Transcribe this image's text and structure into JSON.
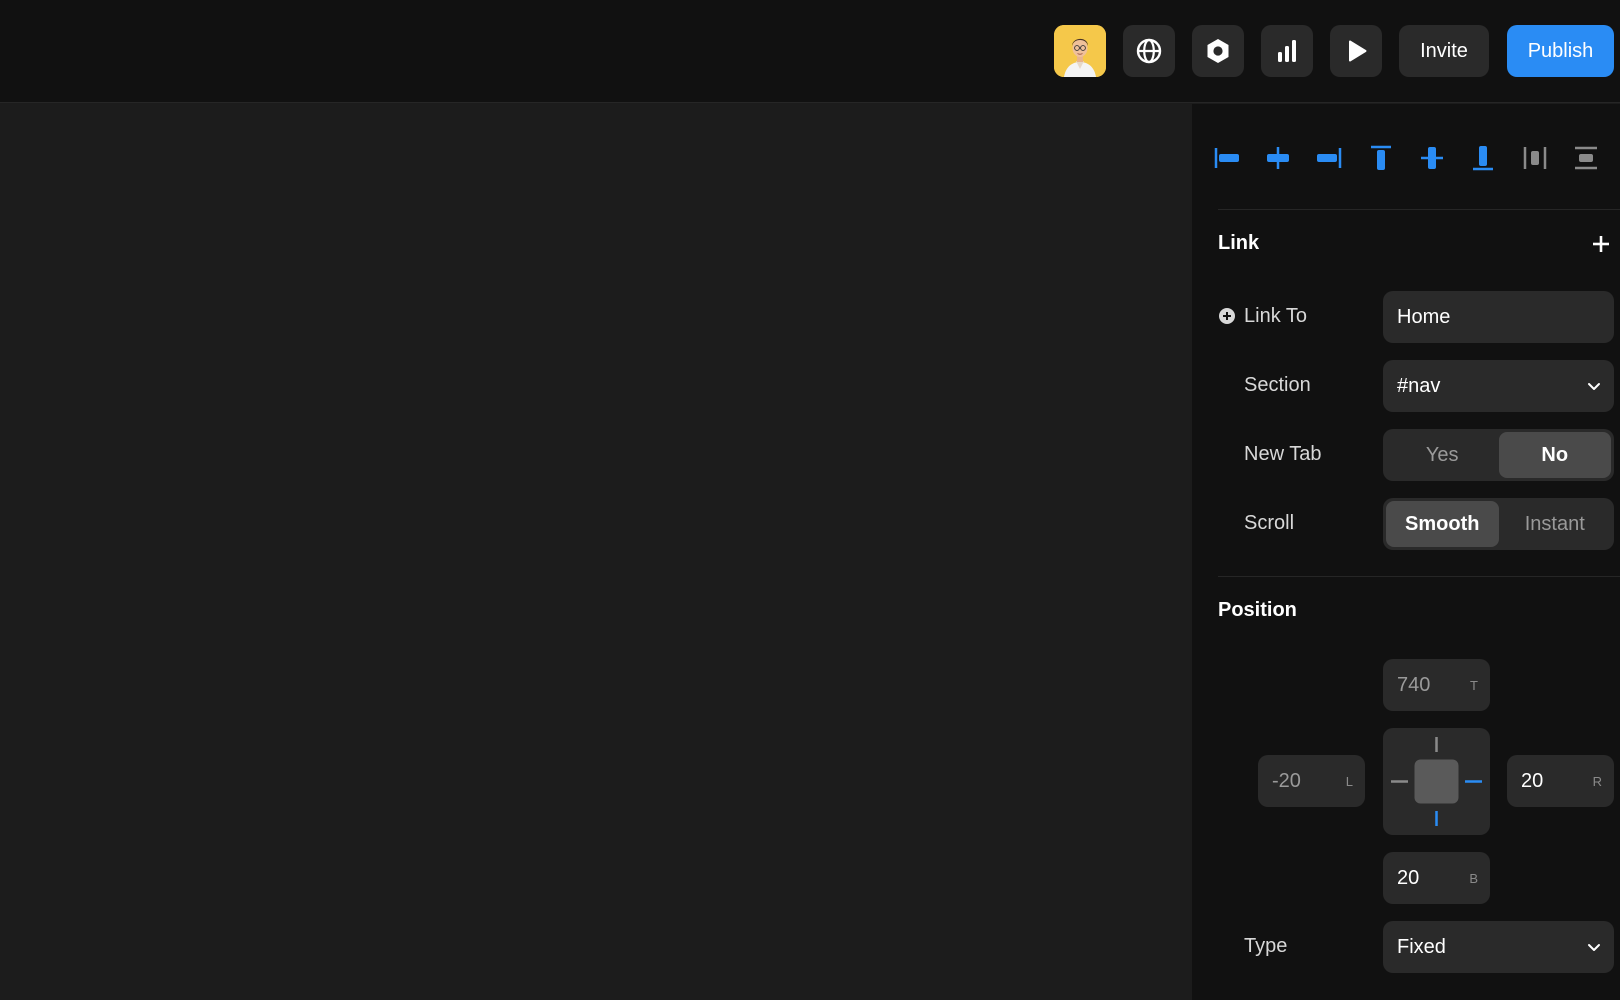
{
  "topbar": {
    "avatar": "user-avatar",
    "icons": [
      "globe-icon",
      "settings-hexagon-icon",
      "bar-chart-icon",
      "play-icon"
    ],
    "invite_label": "Invite",
    "publish_label": "Publish",
    "accent_color": "#2a8cf4"
  },
  "alignment": {
    "icons": [
      "align-left-icon",
      "align-center-horizontal-icon",
      "align-right-icon",
      "align-top-icon",
      "align-center-vertical-icon",
      "align-bottom-icon",
      "distribute-horizontal-icon",
      "distribute-vertical-icon"
    ]
  },
  "link": {
    "title": "Link",
    "link_to_label": "Link To",
    "link_to_value": "Home",
    "section_label": "Section",
    "section_value": "#nav",
    "new_tab_label": "New Tab",
    "new_tab_options": [
      "Yes",
      "No"
    ],
    "new_tab_selected": "No",
    "scroll_label": "Scroll",
    "scroll_options": [
      "Smooth",
      "Instant"
    ],
    "scroll_selected": "Smooth"
  },
  "position": {
    "title": "Position",
    "top_value": "740",
    "top_suffix": "T",
    "left_value": "-20",
    "left_suffix": "L",
    "right_value": "20",
    "right_suffix": "R",
    "bottom_value": "20",
    "bottom_suffix": "B",
    "type_label": "Type",
    "type_value": "Fixed"
  }
}
